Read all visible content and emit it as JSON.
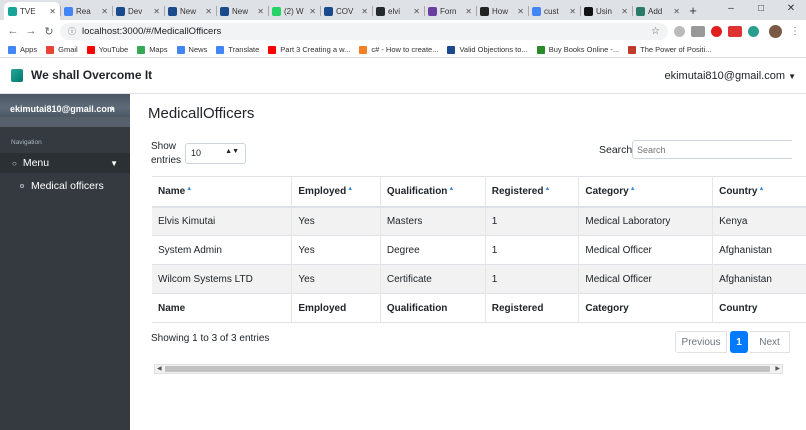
{
  "browser": {
    "tabs": [
      {
        "label": "TVE",
        "color": "#1aa59a",
        "active": true
      },
      {
        "label": "Rea",
        "color": "#4285f4"
      },
      {
        "label": "Dev",
        "color": "#1b4a8c"
      },
      {
        "label": "New",
        "color": "#1b4a8c"
      },
      {
        "label": "New",
        "color": "#1b4a8c"
      },
      {
        "label": "(2) W",
        "color": "#25d366"
      },
      {
        "label": "COV",
        "color": "#1b4a8c"
      },
      {
        "label": "elvi",
        "color": "#24292e"
      },
      {
        "label": "Forn",
        "color": "#6a3ea1"
      },
      {
        "label": "How",
        "color": "#222"
      },
      {
        "label": "cust",
        "color": "#4285f4"
      },
      {
        "label": "Usin",
        "color": "#111"
      },
      {
        "label": "Add",
        "color": "#2a7a6a"
      }
    ],
    "new_tab": "+",
    "url": "localhost:3000/#/MedicallOfficers",
    "bookmarks": [
      {
        "label": "Apps",
        "color": "#4285f4"
      },
      {
        "label": "Gmail",
        "color": "#ea4335"
      },
      {
        "label": "YouTube",
        "color": "#ff0000"
      },
      {
        "label": "Maps",
        "color": "#34a853"
      },
      {
        "label": "News",
        "color": "#4285f4"
      },
      {
        "label": "Translate",
        "color": "#4285f4"
      },
      {
        "label": "Part 3 Creating a w...",
        "color": "#ff0000"
      },
      {
        "label": "c# - How to create...",
        "color": "#f48024"
      },
      {
        "label": "Valid Objections to...",
        "color": "#1b4a8c"
      },
      {
        "label": "Buy Books Online -...",
        "color": "#2a8a2a"
      },
      {
        "label": "The Power of Positi...",
        "color": "#c0392b"
      }
    ]
  },
  "app": {
    "brand": "We shall Overcome It",
    "user_email": "ekimutai810@gmail.com"
  },
  "sidebar": {
    "user": "ekimutai810@gmail.com",
    "heading": "Navigation",
    "menu_label": "Menu",
    "items": [
      {
        "label": "Medical officers"
      }
    ]
  },
  "main": {
    "title": "MedicallOfficers",
    "show_label_1": "Show",
    "show_label_2": "entries",
    "page_length": "10",
    "search_label": "Search",
    "search_placeholder": "Search",
    "columns": [
      "Name",
      "Employed",
      "Qualification",
      "Registered",
      "Category",
      "Country"
    ],
    "rows": [
      [
        "Elvis Kimutai",
        "Yes",
        "Masters",
        "1",
        "Medical Laboratory",
        "Kenya"
      ],
      [
        "System Admin",
        "Yes",
        "Degree",
        "1",
        "Medical Officer",
        "Afghanistan"
      ],
      [
        "Wilcom Systems LTD",
        "Yes",
        "Certificate",
        "1",
        "Medical Officer",
        "Afghanistan"
      ]
    ],
    "info": "Showing 1 to 3 of 3 entries",
    "pagination": {
      "previous": "Previous",
      "current": "1",
      "next": "Next"
    }
  }
}
